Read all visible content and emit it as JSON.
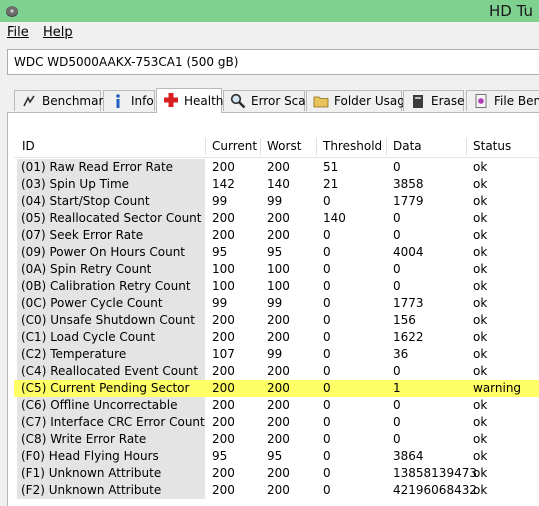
{
  "window": {
    "title": "HD Tu"
  },
  "menu": {
    "file": "File",
    "help": "Help"
  },
  "drive": {
    "selected": "WDC WD5000AAKX-753CA1 (500 gB)"
  },
  "tabs": [
    {
      "label": "Benchmark",
      "icon": "benchmark-icon"
    },
    {
      "label": "Info",
      "icon": "info-icon"
    },
    {
      "label": "Health",
      "icon": "health-cross-icon",
      "active": true
    },
    {
      "label": "Error Scan",
      "icon": "magnifier-icon"
    },
    {
      "label": "Folder Usage",
      "icon": "folder-icon"
    },
    {
      "label": "Erase",
      "icon": "erase-icon"
    },
    {
      "label": "File Bench",
      "icon": "file-bench-icon"
    }
  ],
  "table": {
    "columns": [
      "ID",
      "Current",
      "Worst",
      "Threshold",
      "Data",
      "Status"
    ],
    "rows": [
      {
        "id": "(01) Raw Read Error Rate",
        "current": "200",
        "worst": "200",
        "threshold": "51",
        "data": "0",
        "status": "ok"
      },
      {
        "id": "(03) Spin Up Time",
        "current": "142",
        "worst": "140",
        "threshold": "21",
        "data": "3858",
        "status": "ok"
      },
      {
        "id": "(04) Start/Stop Count",
        "current": "99",
        "worst": "99",
        "threshold": "0",
        "data": "1779",
        "status": "ok"
      },
      {
        "id": "(05) Reallocated Sector Count",
        "current": "200",
        "worst": "200",
        "threshold": "140",
        "data": "0",
        "status": "ok"
      },
      {
        "id": "(07) Seek Error Rate",
        "current": "200",
        "worst": "200",
        "threshold": "0",
        "data": "0",
        "status": "ok"
      },
      {
        "id": "(09) Power On Hours Count",
        "current": "95",
        "worst": "95",
        "threshold": "0",
        "data": "4004",
        "status": "ok"
      },
      {
        "id": "(0A) Spin Retry Count",
        "current": "100",
        "worst": "100",
        "threshold": "0",
        "data": "0",
        "status": "ok"
      },
      {
        "id": "(0B) Calibration Retry Count",
        "current": "100",
        "worst": "100",
        "threshold": "0",
        "data": "0",
        "status": "ok"
      },
      {
        "id": "(0C) Power Cycle Count",
        "current": "99",
        "worst": "99",
        "threshold": "0",
        "data": "1773",
        "status": "ok"
      },
      {
        "id": "(C0) Unsafe Shutdown Count",
        "current": "200",
        "worst": "200",
        "threshold": "0",
        "data": "156",
        "status": "ok"
      },
      {
        "id": "(C1) Load Cycle Count",
        "current": "200",
        "worst": "200",
        "threshold": "0",
        "data": "1622",
        "status": "ok"
      },
      {
        "id": "(C2) Temperature",
        "current": "107",
        "worst": "99",
        "threshold": "0",
        "data": "36",
        "status": "ok"
      },
      {
        "id": "(C4) Reallocated Event Count",
        "current": "200",
        "worst": "200",
        "threshold": "0",
        "data": "0",
        "status": "ok"
      },
      {
        "id": "(C5) Current Pending Sector",
        "current": "200",
        "worst": "200",
        "threshold": "0",
        "data": "1",
        "status": "warning",
        "highlight": true
      },
      {
        "id": "(C6) Offline Uncorrectable",
        "current": "200",
        "worst": "200",
        "threshold": "0",
        "data": "0",
        "status": "ok"
      },
      {
        "id": "(C7) Interface CRC Error Count",
        "current": "200",
        "worst": "200",
        "threshold": "0",
        "data": "0",
        "status": "ok"
      },
      {
        "id": "(C8) Write Error Rate",
        "current": "200",
        "worst": "200",
        "threshold": "0",
        "data": "0",
        "status": "ok"
      },
      {
        "id": "(F0) Head Flying Hours",
        "current": "95",
        "worst": "95",
        "threshold": "0",
        "data": "3864",
        "status": "ok"
      },
      {
        "id": "(F1) Unknown Attribute",
        "current": "200",
        "worst": "200",
        "threshold": "0",
        "data": "13858139473",
        "status": "ok"
      },
      {
        "id": "(F2) Unknown Attribute",
        "current": "200",
        "worst": "200",
        "threshold": "0",
        "data": "42196068432",
        "status": "ok"
      }
    ]
  },
  "colors": {
    "titlebar": "#7ed18e",
    "warning_highlight": "#ffff66",
    "id_column": "#e4e4e4"
  }
}
